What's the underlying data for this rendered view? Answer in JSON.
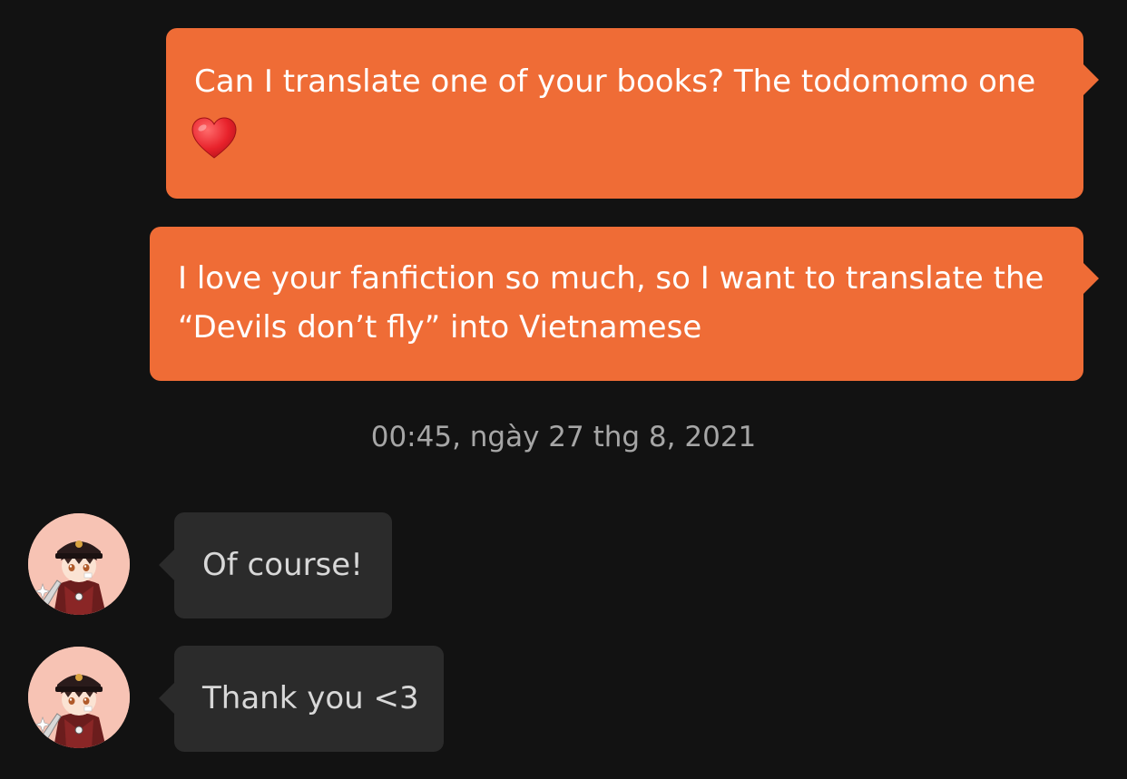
{
  "colors": {
    "background": "#121212",
    "outgoing_bubble": "#ef6c36",
    "incoming_bubble": "#2b2b2b",
    "timestamp_text": "#a6a6a6"
  },
  "outgoing_messages": [
    {
      "line1": "Can I translate one of your books? The todomomo one",
      "emoji": "red-heart-icon"
    },
    {
      "line1": "I love your fanfiction so much, so I want to translate the",
      "line2": "“Devils don’t fly” into Vietnamese"
    }
  ],
  "timestamp": "00:45, ngày 27 thg 8, 2021",
  "incoming_messages": [
    {
      "text": "Of course!",
      "avatar": "anime-boy-avatar"
    },
    {
      "text": "Thank you <3",
      "avatar": "anime-boy-avatar"
    }
  ]
}
